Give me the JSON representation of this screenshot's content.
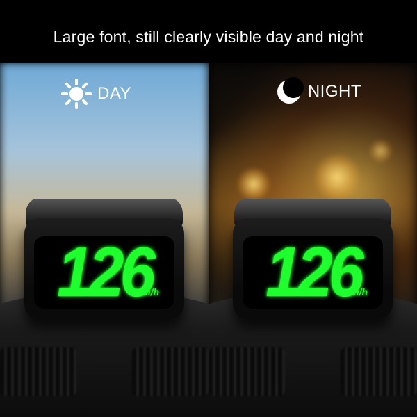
{
  "headline": "Large font, still clearly visible day and night",
  "day": {
    "label": "DAY",
    "speed": "126",
    "unit": "Km/h"
  },
  "night": {
    "label": "NIGHT",
    "speed": "126",
    "unit": "Km/h"
  }
}
